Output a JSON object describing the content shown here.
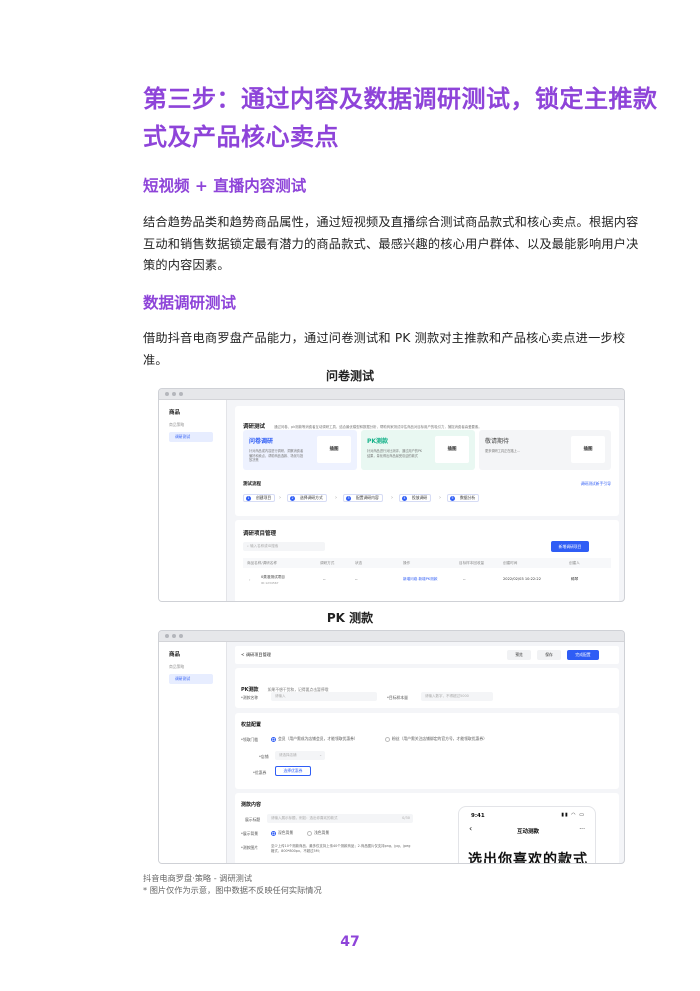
{
  "title": "第三步：通过内容及数据调研测试，锁定主推款式及产品核心卖点",
  "section1": {
    "heading": "短视频 + 直播内容测试",
    "body": "结合趋势品类和趋势商品属性，通过短视频及直播综合测试商品款式和核心卖点。根据内容互动和销售数据锁定最有潜力的商品款式、最感兴趣的核心用户群体、以及最能影响用户决策的内容因素。"
  },
  "section2": {
    "heading": "数据调研测试",
    "body": "借助抖音电商罗盘产品能力，通过问卷测试和 PK 测款对主推款和产品核心卖点进一步校准。"
  },
  "fig1": {
    "title": "问卷测试",
    "sidebar": {
      "title": "商品",
      "sub": "商品策略",
      "item": "调研测试"
    },
    "header_title": "调研测试",
    "header_desc": "通过问卷、pk测款等消费者互动调研工具，结合最优模型和数据分析，帮助商家测试评估商品对目标用户的吸引力，捕捉消费者喜爱要素。",
    "cards": [
      {
        "name": "问卷调研",
        "desc": "针对商品或内容进行调研，洞察消费者偏好和卖点，帮助商品选款、场景与投放决策",
        "img": "插图"
      },
      {
        "name": "PK测款",
        "desc": "针对商品进行对比测评，通过用户的PK结果，量化得出商品最受欢迎的款式",
        "img": "插图"
      },
      {
        "name": "敬请期待",
        "desc": "更多调研工具正在路上…",
        "img": "插图"
      }
    ],
    "flow_title": "测试流程",
    "flow_link": "调研测试新手引导",
    "steps": [
      "创建项目",
      "选择调研方式",
      "配置调研内容",
      "投放调研",
      "数据分析"
    ],
    "manage_title": "调研项目管理",
    "search_placeholder": "输入名称或ID搜索",
    "new_button": "新增调研项目",
    "columns": [
      "商品名称/调研名称",
      "调研方式",
      "状态",
      "操作",
      "目标样本回收量",
      "创建时间",
      "创建人"
    ],
    "row": {
      "name": "0类准测试项目",
      "id": "ID:1234567",
      "mode": "--",
      "status": "--",
      "ops": "新增问卷  新增PK测款",
      "sample": "--",
      "time": "2022/02/03 10:22:22",
      "creator": "稀琴"
    }
  },
  "fig2": {
    "title": "PK 测款",
    "sidebar": {
      "title": "商品",
      "sub": "商品策略",
      "item": "调研测试"
    },
    "back_label": "< 调研项目管理",
    "btn_preview": "预览",
    "btn_save": "保存",
    "btn_done": "完成配置",
    "pk_title": "PK测款",
    "pk_desc": "如果不想干货和，记得要点击暂停哦",
    "name_label": "*测款名称",
    "name_placeholder": "请输入",
    "sample_label": "*目标样本量",
    "sample_placeholder": "请输入数字，不得超过5000",
    "reward_title": "权益配置",
    "threshold_label": "*领取门槛",
    "opt_member": "会员（用户需成为店铺会员，才能领取优惠券）",
    "opt_fans": "粉丝（用户需关注店铺绑定的官方号，才能领取优惠券）",
    "shop_label": "*店铺",
    "shop_placeholder": "请选择店铺",
    "coupon_label": "*优惠券",
    "coupon_button": "选择优惠券",
    "content_title": "测款内容",
    "display_label": "展示标题",
    "display_placeholder": "请输入展示标题，例如：选出你喜欢的款式",
    "display_count": "0/30",
    "bg_label": "*展示背景",
    "bg_dark": "深色背景",
    "bg_light": "浅色背景",
    "image_label": "*测款图片",
    "image_desc": "至少上传10个测款商品，最多仅支持上传40个测款商品；2.商品图片仅支持png、jpg、jpeg格式，800*800px，不超过5M;",
    "phone": {
      "time": "9:41",
      "status": "▮▮ ◠ ▭",
      "title": "互动测款",
      "more": "···",
      "big": "选出你喜欢的款式"
    }
  },
  "caption1": "抖音电商罗盘·策略 - 调研测试",
  "caption2": "* 图片仅作为示意，图中数据不反映任何实际情况",
  "page_number": "47",
  "colors": {
    "accent": "#8e44d9",
    "blue": "#2f5df5",
    "green": "#19b38b"
  }
}
